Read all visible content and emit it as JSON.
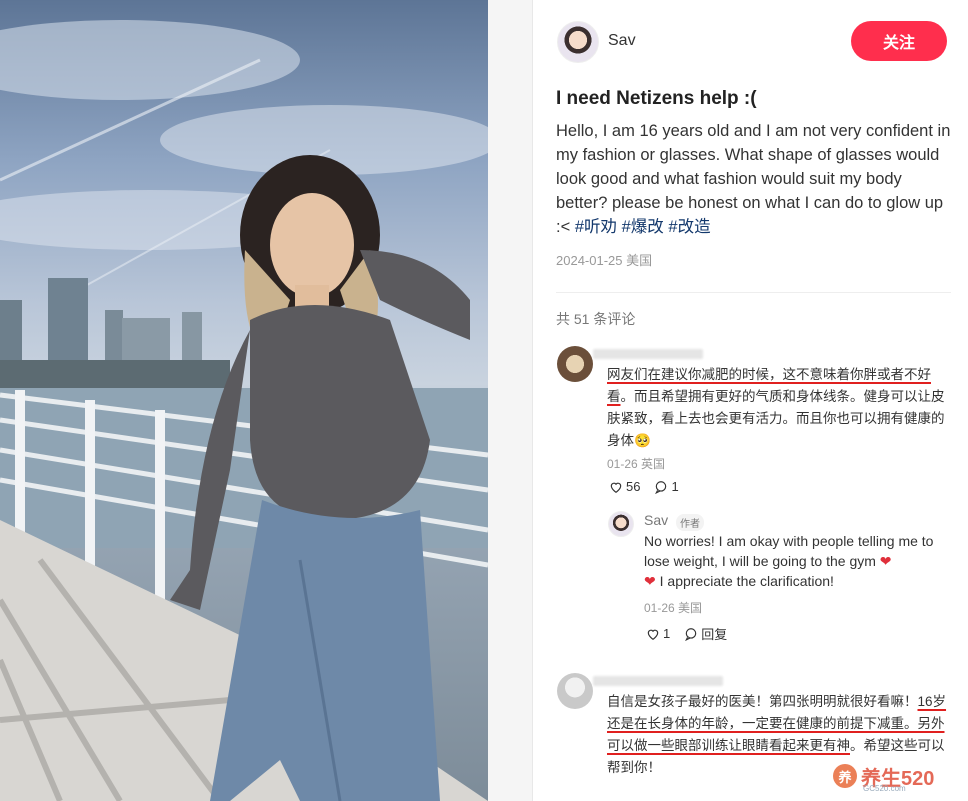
{
  "author": {
    "name": "Sav",
    "follow_label": "关注"
  },
  "note": {
    "title": "I need Netizens help :(",
    "body": "Hello, I am 16 years old and I am not very confident in my fashion or glasses. What shape of glasses would look good and what fashion would suit my body better? please be honest on what I can do to glow up :<",
    "tags": [
      "#听劝",
      "#爆改",
      "#改造"
    ],
    "date": "2024-01-25",
    "location": "美国"
  },
  "comments_header": {
    "count_text": "共 51 条评论"
  },
  "comment1": {
    "text_part1": "网友们在建议你减肥的时候，这不意味着你胖或者不好看",
    "text_part2": "。而且希望拥有更好的气质和身体线条。健身可以让皮肤紧致，看上去也会更有活力。而且你也可以拥有健康的身体",
    "date": "01-26",
    "location": "英国",
    "likes": "56",
    "replies": "1"
  },
  "reply1": {
    "name": "Sav",
    "badge": "作者",
    "text1": "No worries! I am okay with people telling me to lose weight, I will be going to the gym",
    "text2": "I appreciate the clarification!",
    "date": "01-26",
    "location": "美国",
    "likes": "1",
    "reply_label": "回复"
  },
  "comment2": {
    "text_part1": "自信是女孩子最好的医美！第四张明明就很好看嘛！",
    "text_part2": "16岁还是在长身体的年龄，一定要在健康的前提下减重。另外可以做一些眼部训练让眼睛看起来更有神",
    "text_part3": "。希望这些可以帮到你！"
  },
  "watermark": {
    "text": "养生520",
    "sub": "GC520.com"
  },
  "colors": {
    "accent": "#ff2e4d",
    "tag": "#13386c",
    "underline": "#e0201f"
  }
}
